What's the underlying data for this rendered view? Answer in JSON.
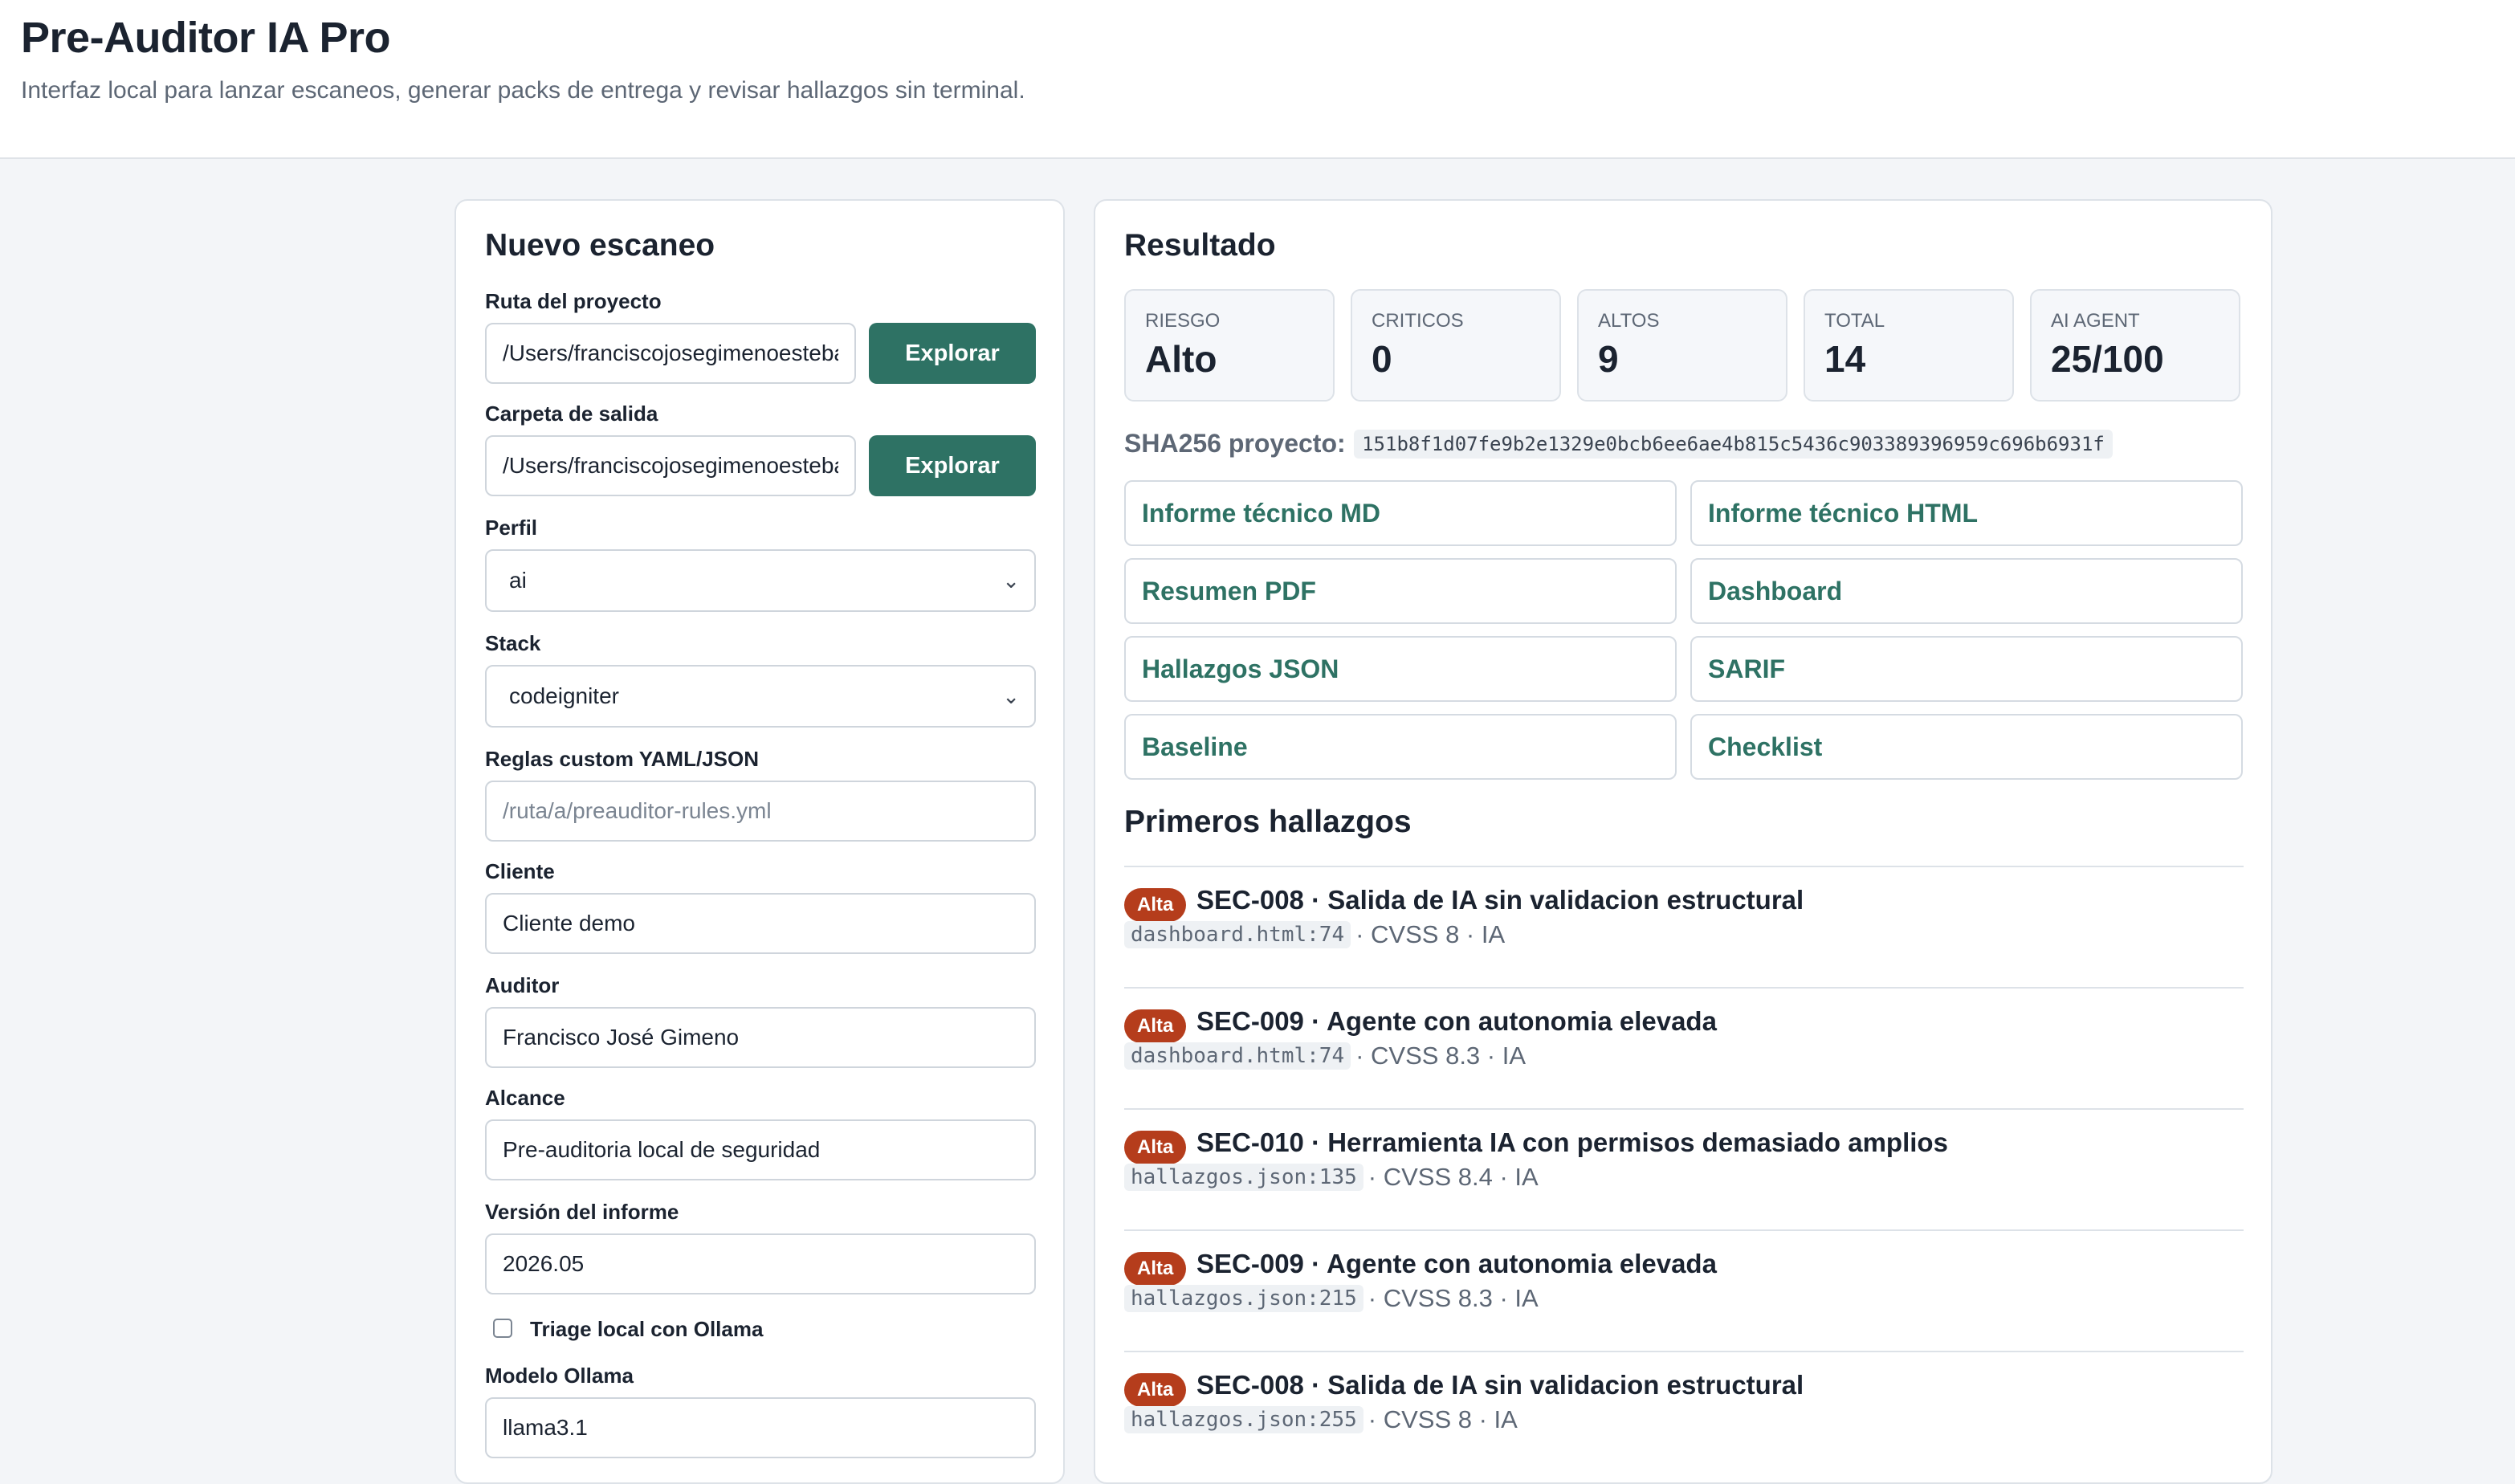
{
  "header": {
    "title": "Pre-Auditor IA Pro",
    "subtitle": "Interfaz local para lanzar escaneos, generar packs de entrega y revisar hallazgos sin terminal."
  },
  "scan_form": {
    "title": "Nuevo escaneo",
    "project_path": {
      "label": "Ruta del proyecto",
      "value": "/Users/franciscojosegimenoestebanez",
      "button": "Explorar"
    },
    "output_folder": {
      "label": "Carpeta de salida",
      "value": "/Users/franciscojosegimenoestebanez",
      "button": "Explorar"
    },
    "profile": {
      "label": "Perfil",
      "value": "ai"
    },
    "stack": {
      "label": "Stack",
      "value": "codeigniter"
    },
    "custom_rules": {
      "label": "Reglas custom YAML/JSON",
      "placeholder": "/ruta/a/preauditor-rules.yml"
    },
    "client": {
      "label": "Cliente",
      "value": "Cliente demo"
    },
    "auditor": {
      "label": "Auditor",
      "value": "Francisco José Gimeno"
    },
    "scope": {
      "label": "Alcance",
      "value": "Pre-auditoria local de seguridad"
    },
    "report_version": {
      "label": "Versión del informe",
      "value": "2026.05"
    },
    "ollama_triage": {
      "label": "Triage local con Ollama",
      "checked": false
    },
    "ollama_model": {
      "label": "Modelo Ollama",
      "value": "llama3.1"
    }
  },
  "result": {
    "title": "Resultado",
    "stats": [
      {
        "label": "Riesgo",
        "value": "Alto"
      },
      {
        "label": "Criticos",
        "value": "0"
      },
      {
        "label": "Altos",
        "value": "9"
      },
      {
        "label": "Total",
        "value": "14"
      },
      {
        "label": "AI Agent",
        "value": "25/100"
      }
    ],
    "sha_label": "SHA256 proyecto:",
    "sha_value": "151b8f1d07fe9b2e1329e0bcb6ee6ae4b815c5436c903389396959c696b6931f",
    "links": [
      "Informe técnico MD",
      "Informe técnico HTML",
      "Resumen PDF",
      "Dashboard",
      "Hallazgos JSON",
      "SARIF",
      "Baseline",
      "Checklist"
    ],
    "findings_title": "Primeros hallazgos",
    "findings": [
      {
        "severity": "Alta",
        "title": "SEC-008 · Salida de IA sin validacion estructural",
        "file": "dashboard.html:74",
        "meta": "· CVSS 8 · IA"
      },
      {
        "severity": "Alta",
        "title": "SEC-009 · Agente con autonomia elevada",
        "file": "dashboard.html:74",
        "meta": "· CVSS 8.3 · IA"
      },
      {
        "severity": "Alta",
        "title": "SEC-010 · Herramienta IA con permisos demasiado amplios",
        "file": "hallazgos.json:135",
        "meta": "· CVSS 8.4 · IA"
      },
      {
        "severity": "Alta",
        "title": "SEC-009 · Agente con autonomia elevada",
        "file": "hallazgos.json:215",
        "meta": "· CVSS 8.3 · IA"
      },
      {
        "severity": "Alta",
        "title": "SEC-008 · Salida de IA sin validacion estructural",
        "file": "hallazgos.json:255",
        "meta": "· CVSS 8 · IA"
      }
    ]
  }
}
